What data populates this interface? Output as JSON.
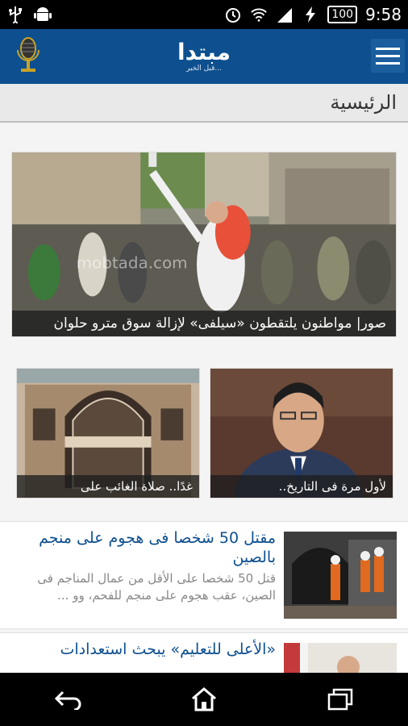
{
  "status_bar": {
    "battery": "100",
    "time": "9:58",
    "icons": [
      "usb-icon",
      "android-icon",
      "alarm-icon",
      "wifi-icon",
      "signal-icon",
      "charging-icon",
      "battery-icon"
    ]
  },
  "app_bar": {
    "logo_text": "مبتدا",
    "logo_subtext": "قبل الخبر...",
    "menu_icon": "hamburger-menu-icon",
    "mic_icon": "microphone-icon"
  },
  "section": {
    "title": "الرئيسية"
  },
  "hero": {
    "caption": "صور| مواطنون يلتقطون «سيلفى» لإزالة سوق مترو حلوان",
    "watermark": "mobtada.com"
  },
  "cards": [
    {
      "caption": "لأول مرة فى التاريخ.."
    },
    {
      "caption": "غدًا.. صلاة الغائب على"
    }
  ],
  "list": [
    {
      "title": "مقتل 50 شخصا فى هجوم على منجم بالصين",
      "desc": "قتل 50 شخصا على الأقل من عمال المناجم فى الصين، عقب هجوم على منجم للفحم، وو ..."
    },
    {
      "title": "«الأعلى للتعليم» يبحث استعدادات",
      "desc": ""
    }
  ],
  "nav": {
    "back": "back-icon",
    "home": "home-icon",
    "recents": "recents-icon"
  },
  "colors": {
    "brand_blue": "#0d4f8f",
    "status_black": "#000000"
  }
}
